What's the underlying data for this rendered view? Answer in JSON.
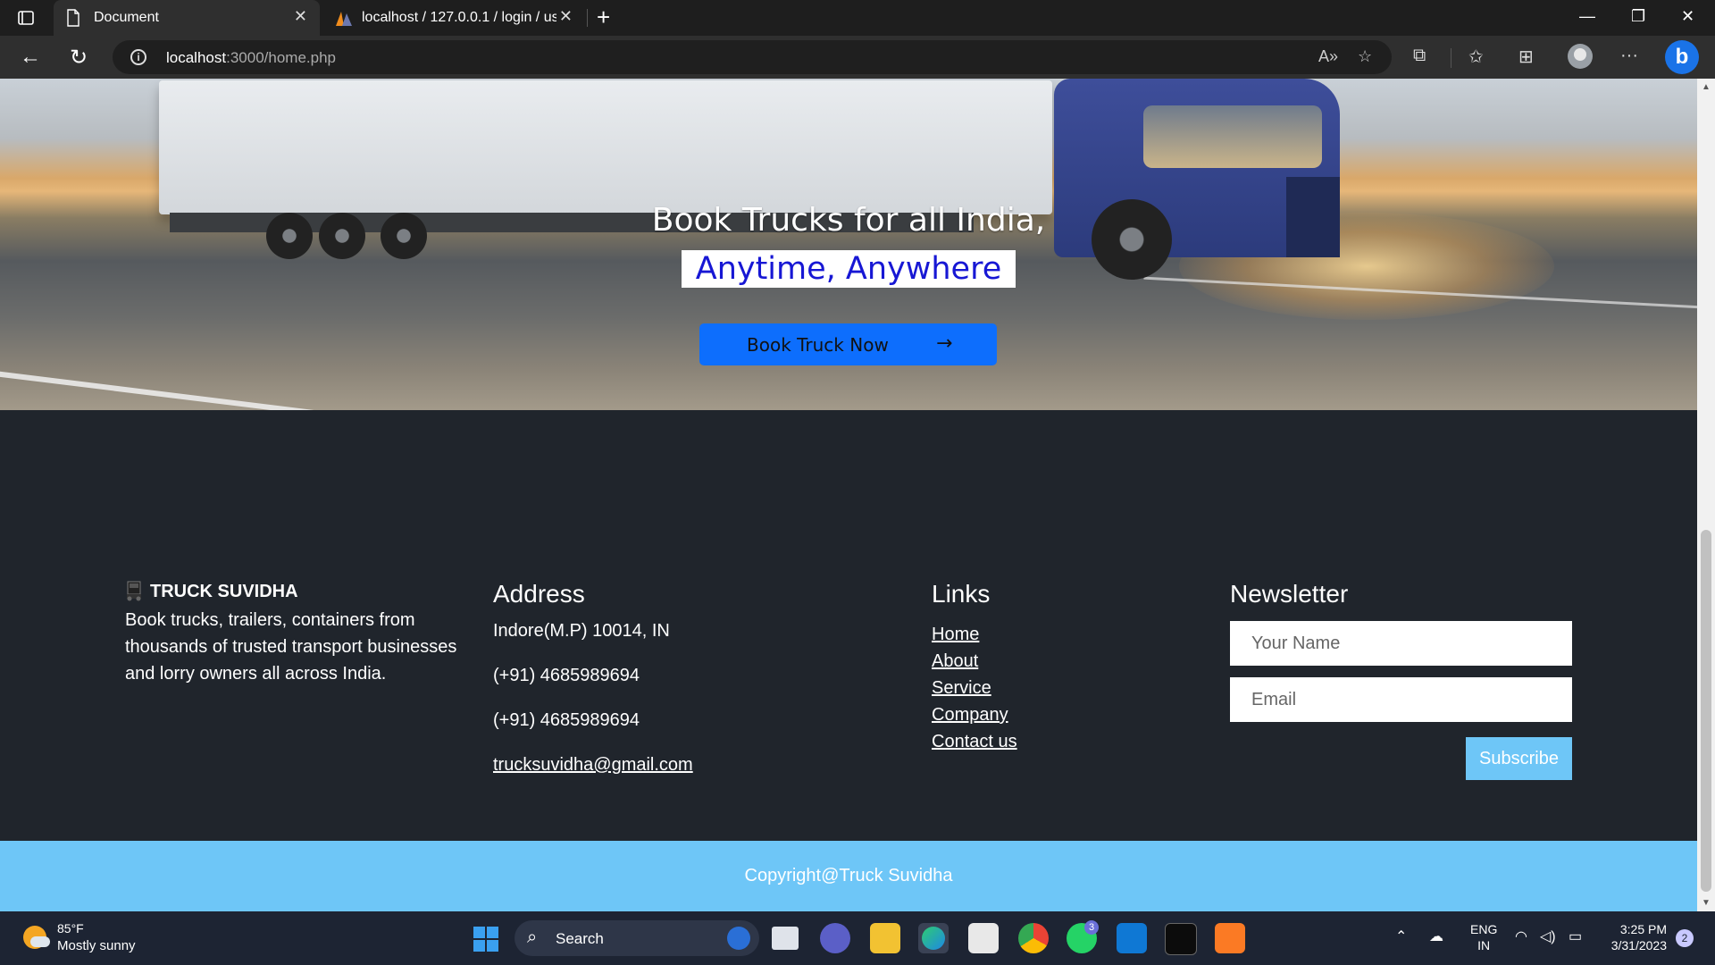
{
  "browser": {
    "tabs": [
      {
        "title": "Document",
        "active": true
      },
      {
        "title": "localhost / 127.0.0.1 / login / use",
        "active": false
      }
    ],
    "url_host": "localhost",
    "url_path": ":3000/home.php"
  },
  "hero": {
    "title": "Book Trucks for all India,",
    "subtitle": "Anytime, Anywhere",
    "button_label": "Book Truck Now",
    "button_arrow": "→"
  },
  "footer": {
    "brand": {
      "name": "TRUCK SUVIDHA",
      "description": "Book trucks, trailers, containers from thousands of trusted transport businesses and lorry owners all across India."
    },
    "address": {
      "heading": "Address",
      "location": "Indore(M.P) 10014, IN",
      "phone1": "(+91) 4685989694",
      "phone2": "(+91) 4685989694",
      "email": "trucksuvidha@gmail.com"
    },
    "links": {
      "heading": "Links",
      "items": [
        "Home",
        "About",
        "Service",
        "Company",
        "Contact us"
      ]
    },
    "newsletter": {
      "heading": "Newsletter",
      "name_placeholder": "Your Name",
      "email_placeholder": "Email",
      "button_label": "Subscribe"
    },
    "copyright": "Copyright@Truck Suvidha"
  },
  "taskbar": {
    "weather_temp": "85°F",
    "weather_condition": "Mostly sunny",
    "search_label": "Search",
    "whatsapp_badge": "3",
    "language": "ENG",
    "region": "IN",
    "time": "3:25 PM",
    "date": "3/31/2023",
    "notifications": "2"
  },
  "colors": {
    "primary_button": "#0d6efd",
    "accent_light_blue": "#6ec6f7",
    "footer_bg": "#20252c",
    "subtitle_text": "#1717d4"
  }
}
